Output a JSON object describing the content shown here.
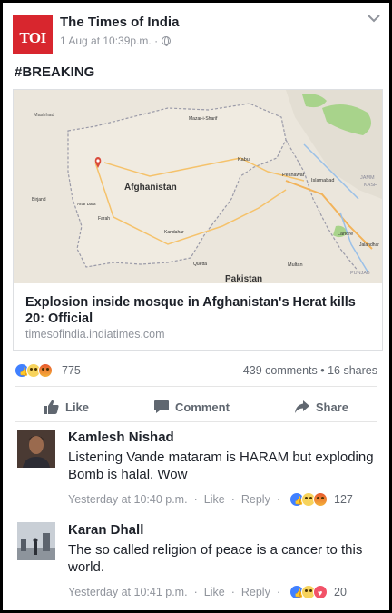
{
  "post": {
    "page_name": "The Times of India",
    "logo_text": "TOI",
    "timestamp": "1 Aug at 10:39p.m. ·",
    "text": "#BREAKING"
  },
  "link": {
    "map_labels": [
      "Mashhad",
      "Afghanistan",
      "Pakistan",
      "Kabul",
      "Peshawar",
      "Islamabad",
      "Lahore",
      "Quetta",
      "Multan",
      "Kandahar",
      "Farah",
      "Mazar-i-Sharif",
      "JAMM",
      "KASH",
      "PUNJAB",
      "Birjand",
      "Anar Dara",
      "Jalandhar"
    ],
    "title": "Explosion inside mosque in Afghanistan's Herat kills 20: Official",
    "domain": "timesofindia.indiatimes.com"
  },
  "stats": {
    "reactions_count": "775",
    "comments_shares": "439 comments • 16 shares"
  },
  "actions": {
    "like": "Like",
    "comment": "Comment",
    "share": "Share"
  },
  "comments": [
    {
      "name": "Kamlesh Nishad",
      "text": "Listening Vande mataram is HARAM but exploding Bomb is halal. Wow",
      "time": "Yesterday at 10:40 p.m.",
      "like": "Like",
      "reply": "Reply",
      "count": "127"
    },
    {
      "name": "Karan Dhall",
      "text": "The so called religion of peace is a cancer to this world.",
      "time": "Yesterday at 10:41 p.m.",
      "like": "Like",
      "reply": "Reply",
      "count": "20"
    }
  ],
  "colors": {
    "brand_red": "#d8262e",
    "facebook_blue": "#4080ff",
    "text": "#1d2129",
    "secondary": "#90949c"
  }
}
